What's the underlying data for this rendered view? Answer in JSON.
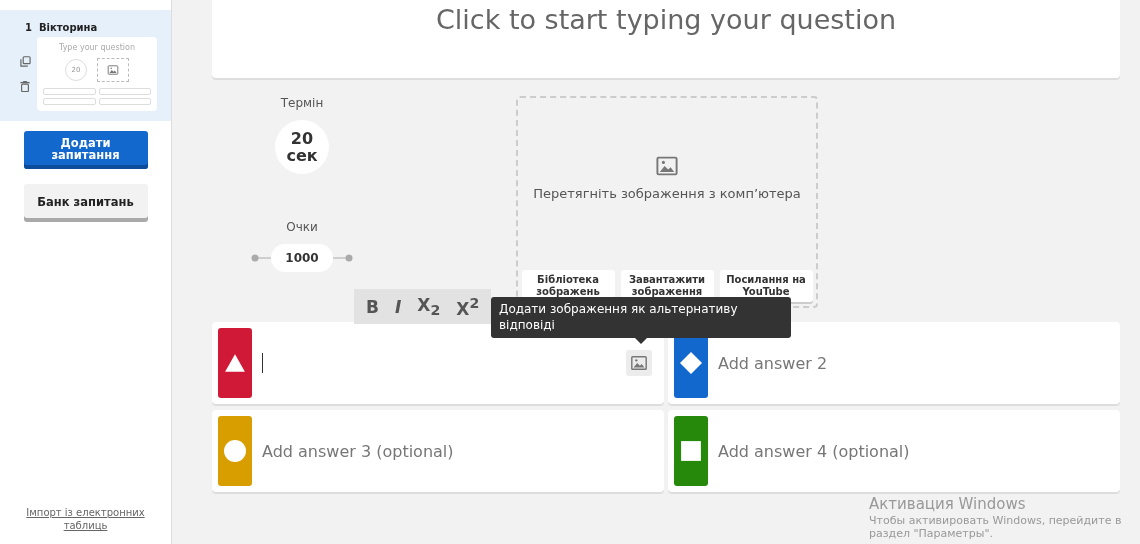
{
  "sidebar": {
    "slides": [
      {
        "number": "1",
        "type": "Вікторина",
        "selected": true,
        "thumbnail": {
          "question_placeholder": "Type your question",
          "timer": "20"
        }
      }
    ],
    "buttons": [
      {
        "label": "Додати запитання",
        "kind": "primary"
      },
      {
        "label": "Банк запитань",
        "kind": "secondary"
      }
    ],
    "import_link": "Імпорт із електронних таблиць"
  },
  "question": {
    "placeholder": "Click to start typing your question"
  },
  "settings": {
    "time_label": "Термін",
    "time_value": "20",
    "time_unit": "сек",
    "points_label": "Очки",
    "points_value": "1000"
  },
  "media": {
    "hint": "Перетягніть зображення з комп’ютера",
    "buttons": [
      "Бібліотека зображень",
      "Завантажити зображення",
      "Посилання на YouTube"
    ]
  },
  "format_toolbar": [
    {
      "label": "B",
      "kind": "bold"
    },
    {
      "label": "I",
      "kind": "italic"
    },
    {
      "label": "X$_{2}$",
      "kind": "script"
    },
    {
      "label": "X$^{2}$",
      "kind": "script"
    }
  ],
  "tooltip": "Додати зображення як альтернативу відповіді",
  "answers": [
    {
      "kind": "triangle",
      "color": "#d01937",
      "focused": true
    },
    {
      "placeholder": "Add answer 2",
      "kind": "diamond",
      "color": "#1368ce",
      "focused": false
    },
    {
      "placeholder": "Add answer 3 (optional)",
      "kind": "circle",
      "color": "#d89e00",
      "focused": false
    },
    {
      "placeholder": "Add answer 4 (optional)",
      "kind": "square",
      "color": "#26890c",
      "focused": false
    }
  ],
  "os_notice": {
    "title": "Активация Windows",
    "text": "Чтобы активировать Windows, перейдите в раздел \"Параметры\"."
  }
}
